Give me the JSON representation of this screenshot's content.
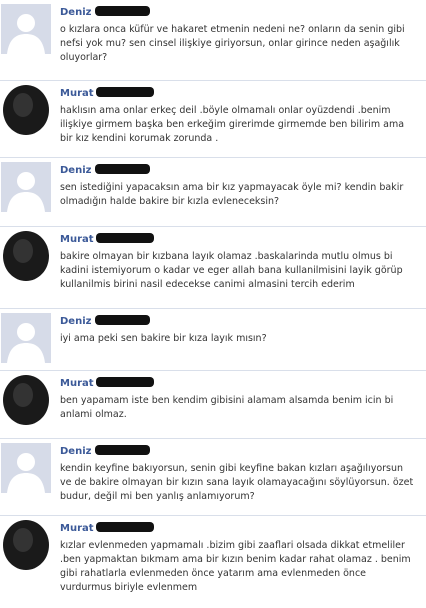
{
  "messages": [
    {
      "author": "Deniz",
      "text": "o kızlara onca küfür ve hakaret etmenin nedeni ne? onların da senin gibi nefsi yok mu? sen cinsel ilişkiye giriyorsun, onlar girince neden aşağılık oluyorlar?"
    },
    {
      "author": "Murat",
      "text": "haklısın ama onlar erkeç deil .böyle olmamalı onlar oyüzdendi .benim ilişkiye girmem başka ben erkeğim girerimde girmemde ben bilirim ama bir kız kendini korumak zorunda ."
    },
    {
      "author": "Deniz",
      "text": "sen istediğini yapacaksın ama bir kız yapmayacak öyle mi? kendin bakir olmadığın halde bakire bir kızla evleneceksin?"
    },
    {
      "author": "Murat",
      "text": "bakire olmayan bir kızbana layık olamaz .baskalarinda mutlu olmus bi kadini istemiyorum o kadar ve eger allah bana kullanilmisini layik görüp kullanilmis birini nasil edecekse canimi almasini tercih ederim"
    },
    {
      "author": "Deniz",
      "text": "iyi ama peki sen bakire bir kıza layık mısın?"
    },
    {
      "author": "Murat",
      "text": "ben yapamam iste ben kendim gibisini alamam alsamda benim icin bi anlami olmaz."
    },
    {
      "author": "Deniz",
      "text": "kendin keyfine bakıyorsun, senin gibi keyfine bakan kızları aşağılıyorsun ve de bakire olmayan bir kızın sana layık olamayacağını söylüyorsun. özet budur, değil mi ben yanlış anlamıyorum?"
    },
    {
      "author": "Murat",
      "text": "kızlar evlenmeden yapmamalı .bizim gibi zaaflari olsada dikkat etmeliler .ben yapmaktan bıkmam ama bir kızın benim kadar rahat olamaz . benim gibi rahatlarla evlenmeden önce yatarım ama evlenmeden önce vurdurmus biriyle evlenmem"
    }
  ]
}
